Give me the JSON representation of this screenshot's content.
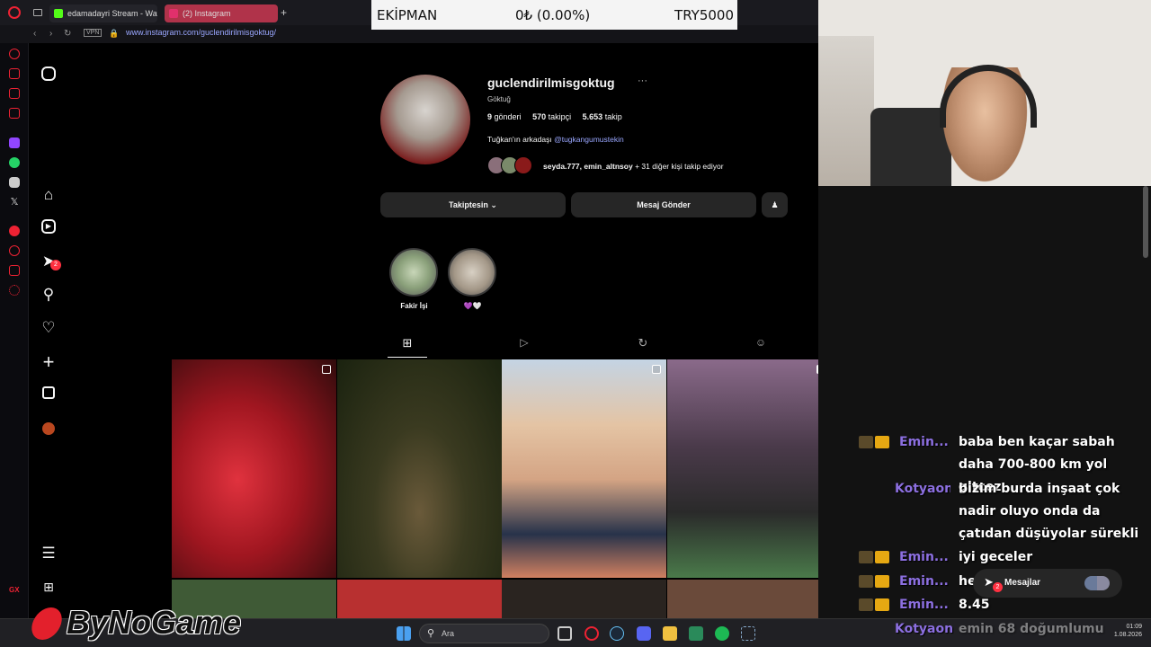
{
  "browser": {
    "tabs": [
      {
        "label": "edamadayri Stream - Watc",
        "active": false,
        "favicon_color": "#53fc18"
      },
      {
        "label": "(2) Instagram",
        "active": true,
        "favicon_color": "#e1306c"
      }
    ],
    "new_tab": "+",
    "vpn_badge": "VPN",
    "url": "www.instagram.com/guclendirilmisgoktug/"
  },
  "overlay": {
    "label": "EKİPMAN",
    "amount": "0₺ (0.00%)",
    "goal": "TRY5000"
  },
  "profile": {
    "username": "guclendirilmisgoktug",
    "more": "···",
    "full_name": "Göktuğ",
    "posts_count": "9",
    "posts_label": "gönderi",
    "followers_count": "570",
    "followers_label": "takipçi",
    "following_count": "5.653",
    "following_label": "takip",
    "bio_prefix": "Tuğkan'ın arkadaşı",
    "bio_mention": "@tugkangumustekin",
    "followed_by_names": "seyda.777, emin_altnsoy",
    "followed_by_rest": "+ 31 diğer kişi takip ediyor"
  },
  "actions": {
    "following": "Takiptesin",
    "message": "Mesaj Gönder"
  },
  "highlights": [
    {
      "label": "Fakir İşi"
    },
    {
      "label": "💜🤍"
    }
  ],
  "notif_count": "2",
  "messages_pill": {
    "label": "Mesajlar",
    "count": "2"
  },
  "chat": [
    {
      "name": "Emin...",
      "msg": "baba ben kaçar sabah daha 700-800 km yol gitcez"
    },
    {
      "name": "Kotyaon",
      "msg": "bizim burda inşaat çok nadir oluyo onda da çatıdan düşüyolar sürekli"
    },
    {
      "name": "Emin...",
      "msg": "iyi geceler"
    },
    {
      "name": "Emin...",
      "msg": "he"
    },
    {
      "name": "Emin...",
      "msg": "8.45"
    },
    {
      "name": "Kotyaon",
      "msg": "emin 68 doğumlumu"
    }
  ],
  "watermark": "ByNoGame",
  "taskbar": {
    "search": "Ara",
    "time": "01:09",
    "date": "1.08.2026"
  },
  "opera_gx": "GX"
}
